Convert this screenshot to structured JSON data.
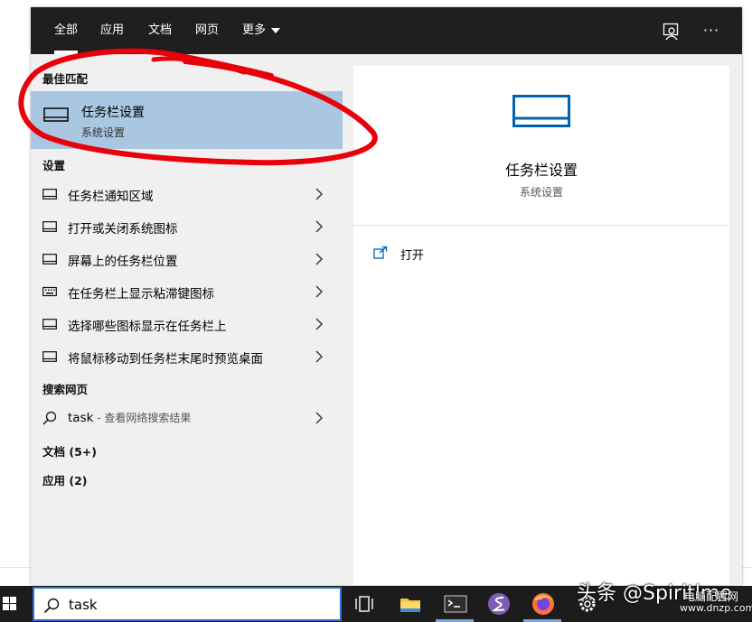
{
  "tabs": [
    {
      "label": "全部",
      "active": true
    },
    {
      "label": "应用",
      "active": false
    },
    {
      "label": "文档",
      "active": false
    },
    {
      "label": "网页",
      "active": false
    },
    {
      "label": "更多",
      "active": false,
      "has_dropdown": true
    }
  ],
  "topbar_icons": {
    "feedback": "feedback-person-icon",
    "more": "ellipsis-icon"
  },
  "best_match": {
    "heading": "最佳匹配",
    "title": "任务栏设置",
    "subtitle": "系统设置",
    "icon": "taskbar-icon"
  },
  "settings": {
    "heading": "设置",
    "items": [
      {
        "label": "任务栏通知区域",
        "icon": "taskbar-icon"
      },
      {
        "label": "打开或关闭系统图标",
        "icon": "taskbar-icon"
      },
      {
        "label": "屏幕上的任务栏位置",
        "icon": "taskbar-icon"
      },
      {
        "label": "在任务栏上显示粘滞键图标",
        "icon": "keyboard-icon"
      },
      {
        "label": "选择哪些图标显示在任务栏上",
        "icon": "taskbar-icon"
      },
      {
        "label": "将鼠标移动到任务栏末尾时预览桌面",
        "icon": "taskbar-icon"
      }
    ]
  },
  "web_search": {
    "heading": "搜索网页",
    "query": "task",
    "suffix": " - 查看网络搜索结果"
  },
  "documents": {
    "heading": "文档 (5+)"
  },
  "apps": {
    "heading": "应用 (2)"
  },
  "preview": {
    "title": "任务栏设置",
    "subtitle": "系统设置",
    "open_label": "打开"
  },
  "search_box": {
    "value": "task"
  },
  "taskbar_apps": [
    {
      "name": "task-view-icon"
    },
    {
      "name": "file-explorer-icon"
    },
    {
      "name": "terminal-icon"
    },
    {
      "name": "emacs-icon"
    },
    {
      "name": "firefox-icon"
    },
    {
      "name": "settings-gear-icon"
    }
  ],
  "watermark": {
    "main": "头条 @Spiritlme",
    "site_top": "电脑配置网",
    "site_bottom": "www.dnzp.com"
  },
  "colors": {
    "topbar": "#1f1f1f",
    "highlight": "#a9c7e1",
    "accent_blue": "#0063b1",
    "annotation_red": "#e8000b",
    "taskbar": "#1c1c1c"
  }
}
